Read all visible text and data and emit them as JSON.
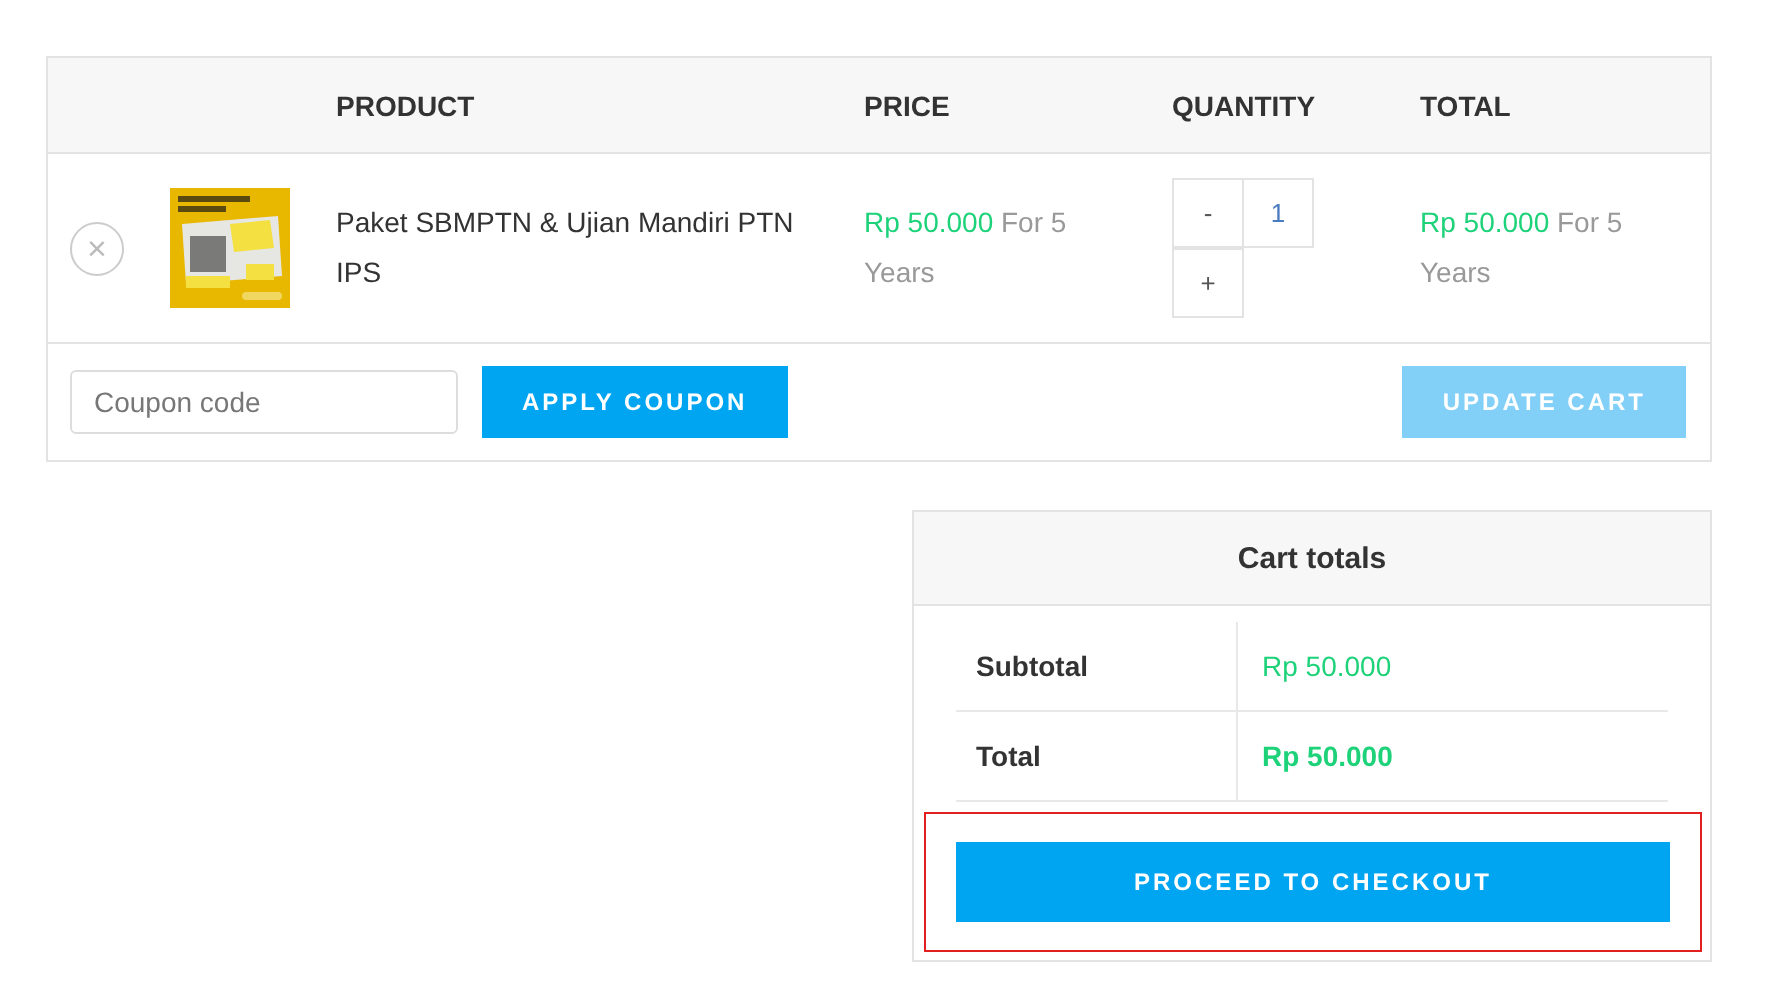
{
  "cart_table": {
    "columns": [
      "PRODUCT",
      "PRICE",
      "QUANTITY",
      "TOTAL"
    ],
    "rows": [
      {
        "remove_icon": "×",
        "product": "Paket SBMPTN & Ujian Mandiri PTN IPS",
        "price": {
          "amount": "Rp 50.000",
          "suffix": "For 5 Years"
        },
        "quantity": {
          "minus": "-",
          "value": "1",
          "plus": "+"
        },
        "total": {
          "amount": "Rp 50.000",
          "suffix": "For 5 Years"
        }
      }
    ],
    "coupon": {
      "placeholder": "Coupon code",
      "apply_button": "APPLY COUPON"
    },
    "update_button": {
      "label": "UPDATE CART",
      "disabled": true
    }
  },
  "cart_totals": {
    "title": "Cart totals",
    "rows": [
      {
        "label": "Subtotal",
        "value": "Rp 50.000",
        "bold": false
      },
      {
        "label": "Total",
        "value": "Rp 50.000",
        "bold": true
      }
    ],
    "checkout_button": "PROCEED TO CHECKOUT",
    "highlighted": true
  }
}
